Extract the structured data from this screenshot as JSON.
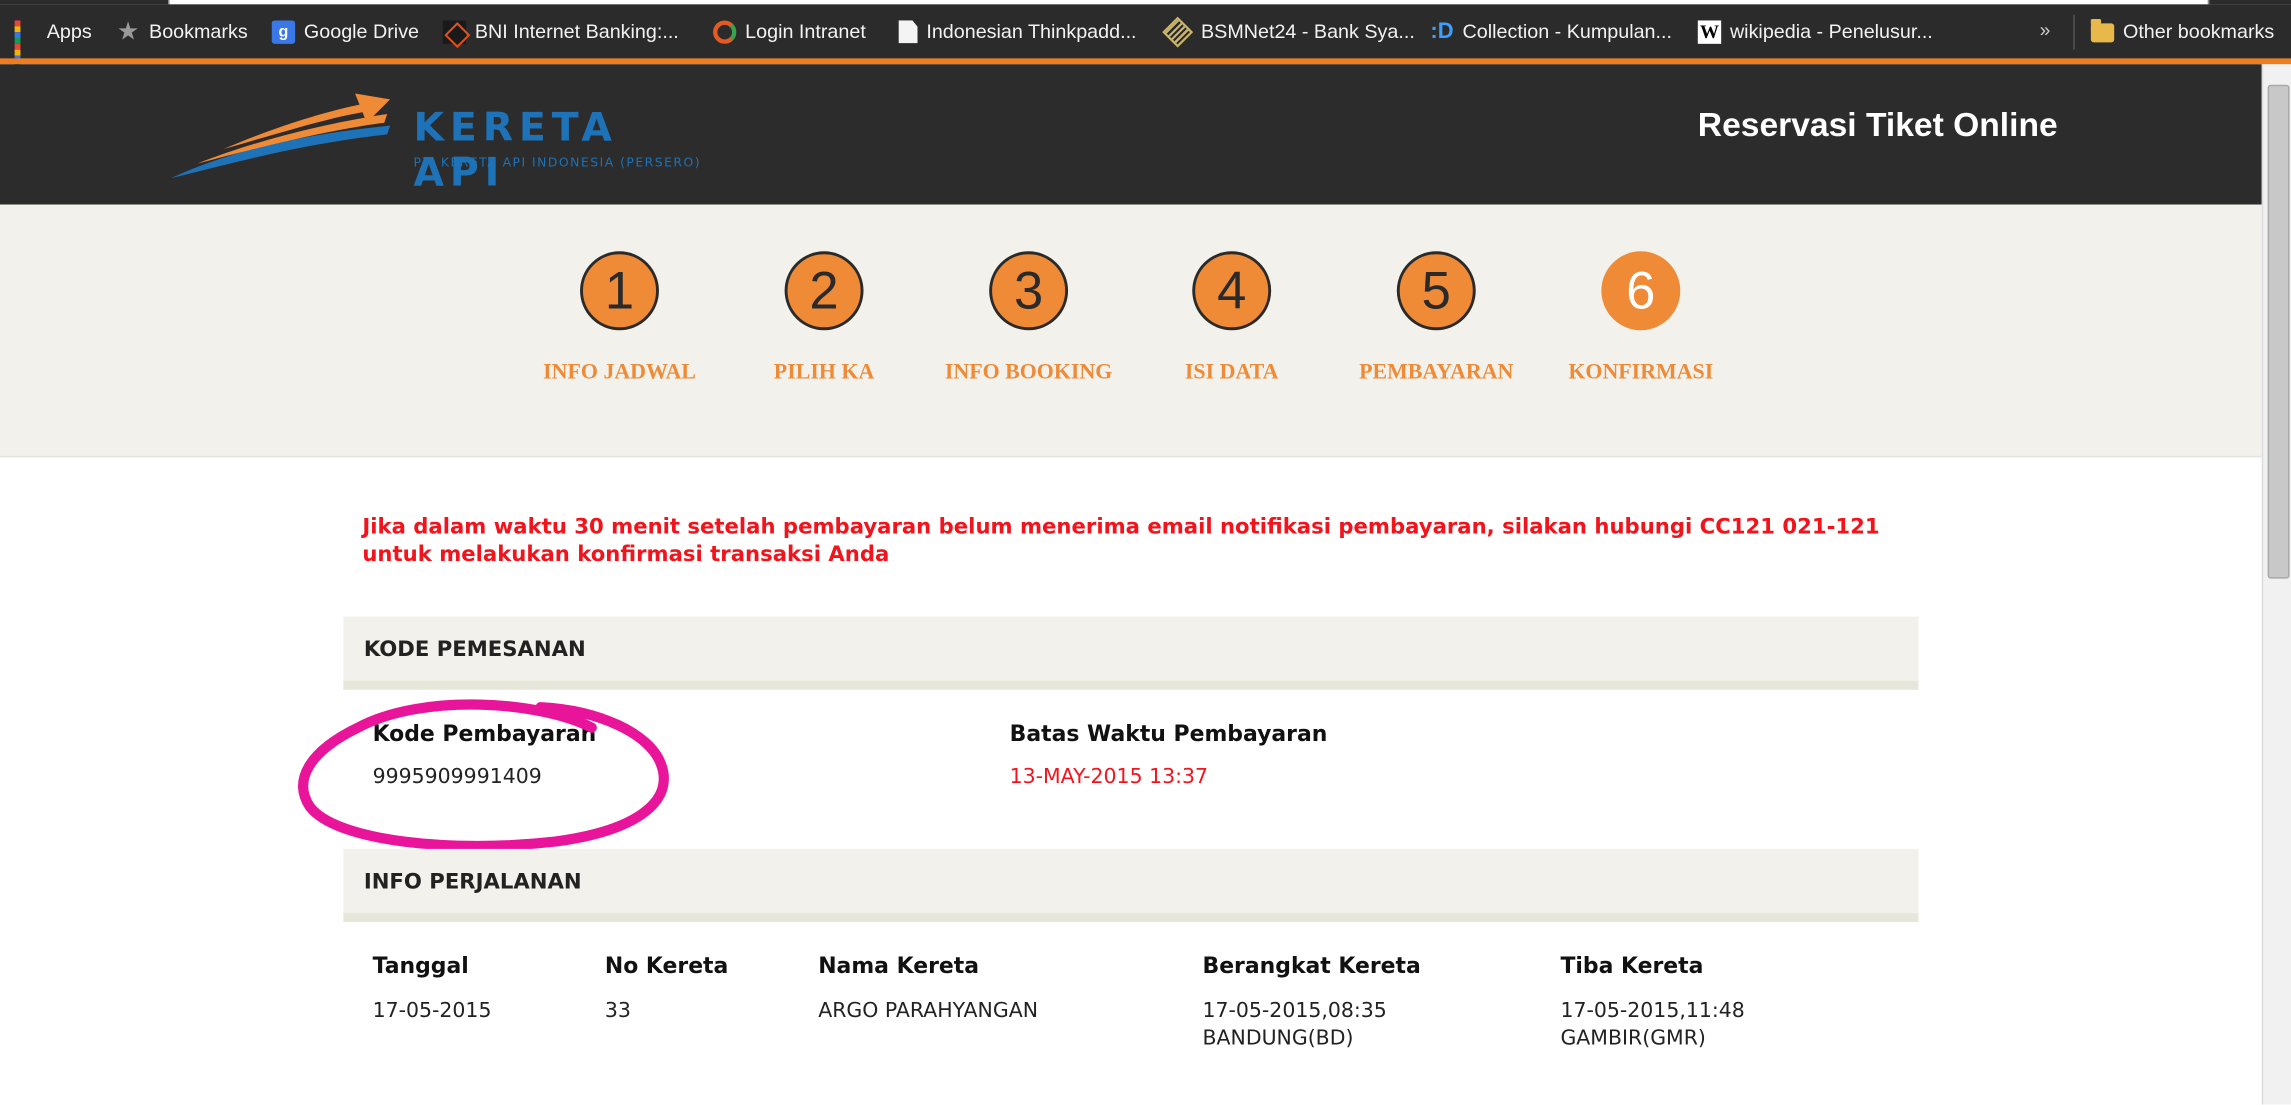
{
  "bookmarks": {
    "items": [
      {
        "label": "Apps",
        "icon": "apps-grid-icon"
      },
      {
        "label": "Bookmarks",
        "icon": "star-icon"
      },
      {
        "label": "Google Drive",
        "icon": "google-icon"
      },
      {
        "label": "BNI Internet Banking:...",
        "icon": "bni-icon"
      },
      {
        "label": "Login Intranet",
        "icon": "login-icon"
      },
      {
        "label": "Indonesian Thinkpadd...",
        "icon": "page-icon"
      },
      {
        "label": "BSMNet24 - Bank Sya...",
        "icon": "bsm-icon"
      },
      {
        "label": "Collection - Kumpulan...",
        "icon": "collection-icon"
      },
      {
        "label": "wikipedia - Penelusur...",
        "icon": "wikipedia-icon"
      }
    ],
    "more": "»",
    "other": "Other bookmarks"
  },
  "header": {
    "logo_name": "KERETA API",
    "logo_sub": "PT. KERETA API INDONESIA (PERSERO)",
    "title": "Reservasi Tiket Online"
  },
  "steps": [
    {
      "num": "1",
      "label": "INFO JADWAL"
    },
    {
      "num": "2",
      "label": "PILIH KA"
    },
    {
      "num": "3",
      "label": "INFO BOOKING"
    },
    {
      "num": "4",
      "label": "ISI DATA"
    },
    {
      "num": "5",
      "label": "PEMBAYARAN"
    },
    {
      "num": "6",
      "label": "KONFIRMASI"
    }
  ],
  "active_step": "6",
  "notice": "Jika dalam waktu 30 menit setelah pembayaran belum menerima email notifikasi pembayaran, silakan hubungi CC121 021-121 untuk melakukan konfirmasi transaksi Anda",
  "kode_pemesanan": {
    "heading": "KODE PEMESANAN",
    "kode_label": "Kode Pembayaran",
    "kode_value": "9995909991409",
    "batas_label": "Batas Waktu Pembayaran",
    "batas_value": "13-MAY-2015 13:37"
  },
  "info_perjalanan": {
    "heading": "INFO PERJALANAN",
    "columns": [
      "Tanggal",
      "No Kereta",
      "Nama Kereta",
      "Berangkat Kereta",
      "Tiba Kereta"
    ],
    "row": {
      "tanggal": "17-05-2015",
      "no_kereta": "33",
      "nama_kereta": "ARGO PARAHYANGAN",
      "berangkat_time": "17-05-2015,08:35",
      "berangkat_station": "BANDUNG(BD)",
      "tiba_time": "17-05-2015,11:48",
      "tiba_station": "GAMBIR(GMR)"
    }
  },
  "colors": {
    "brand_orange": "#ef8a36",
    "brand_blue": "#1d72b8",
    "alert_red": "#f2141c",
    "annotation_magenta": "#e8159a"
  }
}
